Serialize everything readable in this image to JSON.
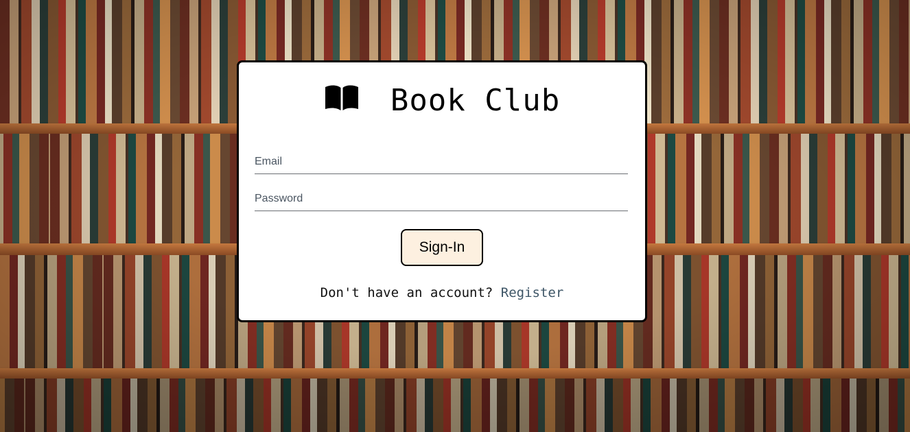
{
  "app": {
    "title": "Book Club",
    "icon": "open-book-icon"
  },
  "form": {
    "email_placeholder": "Email",
    "email_value": "",
    "password_placeholder": "Password",
    "password_value": "",
    "signin_label": "Sign-In"
  },
  "footer": {
    "prompt_text": "Don't have an account?",
    "register_link": "Register"
  },
  "colors": {
    "card_background": "#ffffff",
    "card_border": "#000000",
    "button_background": "#fdf0e0",
    "link_color": "#3d5566"
  },
  "background": {
    "description_icon": "bookshelf-background"
  }
}
